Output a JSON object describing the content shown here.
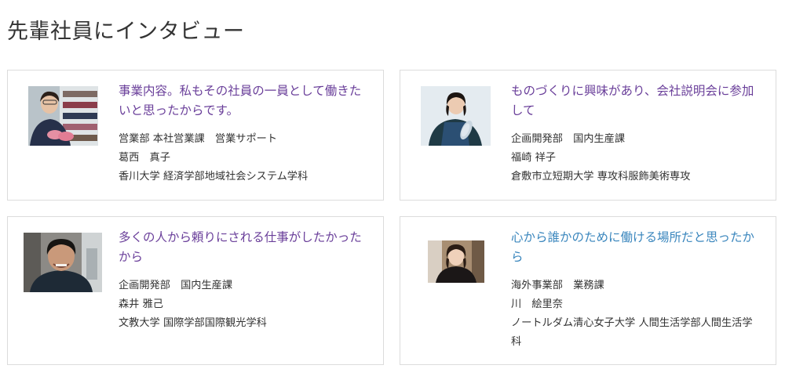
{
  "page": {
    "title": "先輩社員にインタビュー"
  },
  "cards": [
    {
      "headline": "事業内容。私もその社員の一員として働きたいと思ったからです。",
      "department": "営業部 本社営業課　営業サポート",
      "name": "葛西　真子",
      "school": "香川大学 経済学部地域社会システム学科"
    },
    {
      "headline": "ものづくりに興味があり、会社説明会に参加して",
      "department": "企画開発部　国内生産課",
      "name": "福崎 祥子",
      "school": "倉敷市立短期大学 専攻科服飾美術専攻"
    },
    {
      "headline": "多くの人から頼りにされる仕事がしたかったから",
      "department": "企画開発部　国内生産課",
      "name": "森井 雅己",
      "school": "文教大学 国際学部国際観光学科"
    },
    {
      "headline": "心から誰かのために働ける場所だと思ったから",
      "department": "海外事業部　業務課",
      "name": "川　絵里奈",
      "school": "ノートルダム清心女子大学 人間生活学部人間生活学科"
    }
  ],
  "colors": {
    "headline_purple": "#6a3f9a",
    "headline_blue": "#3a86bd",
    "border": "#dcdcdc",
    "text": "#333333"
  }
}
